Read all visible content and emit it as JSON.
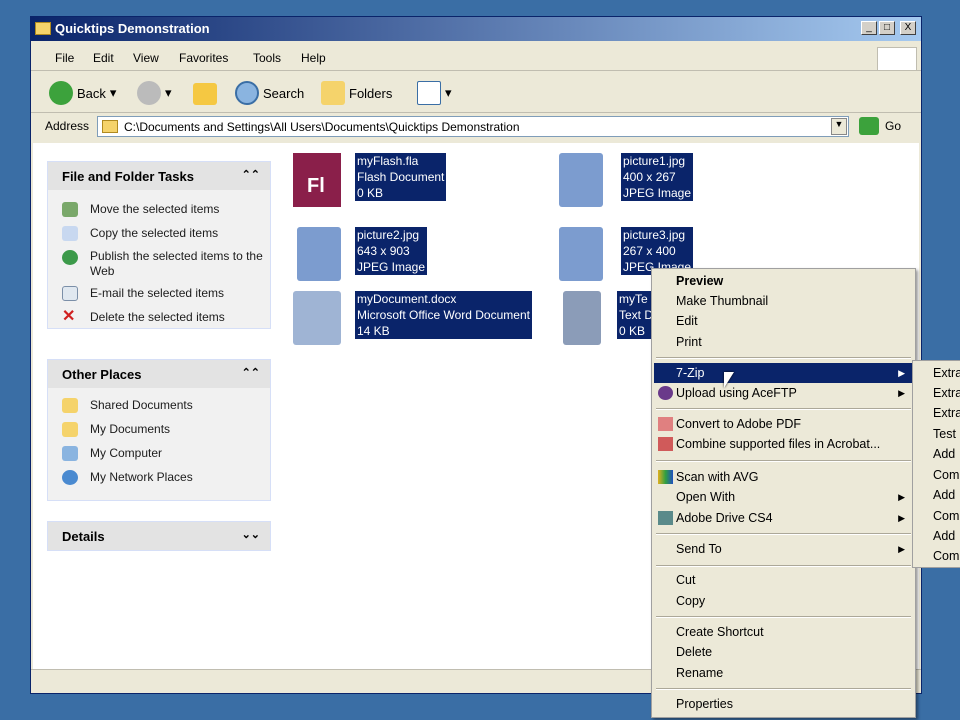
{
  "window": {
    "title": "Quicktips Demonstration",
    "min": "_",
    "max": "□",
    "close": "X"
  },
  "menu": [
    "File",
    "Edit",
    "View",
    "Favorites",
    "Tools",
    "Help"
  ],
  "toolbar": {
    "back": "Back",
    "search": "Search",
    "folders": "Folders"
  },
  "address": {
    "label": "Address",
    "value": "C:\\Documents and Settings\\All Users\\Documents\\Quicktips Demonstration",
    "go": "Go"
  },
  "panels": {
    "tasks": {
      "title": "File and Folder Tasks",
      "items": [
        "Move the selected items",
        "Copy the selected items",
        "Publish the selected items to the Web",
        "E-mail the selected items",
        "Delete the selected items"
      ]
    },
    "places": {
      "title": "Other Places",
      "items": [
        "Shared Documents",
        "My Documents",
        "My Computer",
        "My Network Places"
      ]
    },
    "details": {
      "title": "Details"
    }
  },
  "files": [
    {
      "name": "myFlash.fla",
      "type": "Flash Document",
      "info": "0 KB",
      "icon": "flash-icon"
    },
    {
      "name": "picture1.jpg",
      "type": "400 x 267",
      "info": "JPEG Image",
      "icon": "jpeg-icon"
    },
    {
      "name": "picture2.jpg",
      "type": "643 x 903",
      "info": "JPEG Image",
      "icon": "jpeg-icon"
    },
    {
      "name": "picture3.jpg",
      "type": "267 x 400",
      "info": "JPEG Image",
      "icon": "jpeg-icon"
    },
    {
      "name": "myDocument.docx",
      "type": "Microsoft Office Word Document",
      "info": "14 KB",
      "icon": "word-icon"
    },
    {
      "name": "myTe",
      "type": "Text D",
      "info": "0 KB",
      "icon": "text-icon"
    }
  ],
  "context_menu": {
    "items": [
      "Preview",
      "Make Thumbnail",
      "Edit",
      "Print",
      "7-Zip",
      "Upload using AceFTP",
      "Convert to Adobe PDF",
      "Combine supported files in Acrobat...",
      "Scan with AVG",
      "Open With",
      "Adobe Drive CS4",
      "Send To",
      "Cut",
      "Copy",
      "Create Shortcut",
      "Delete",
      "Rename",
      "Properties"
    ],
    "highlighted": "7-Zip"
  },
  "submenu": [
    "Extra",
    "Extra",
    "Extra",
    "Test",
    "Add",
    "Comp",
    "Add",
    "Comp",
    "Add",
    "Comp"
  ],
  "colors": {
    "selection": "#0a246a",
    "desktop": "#3a6ea5"
  }
}
